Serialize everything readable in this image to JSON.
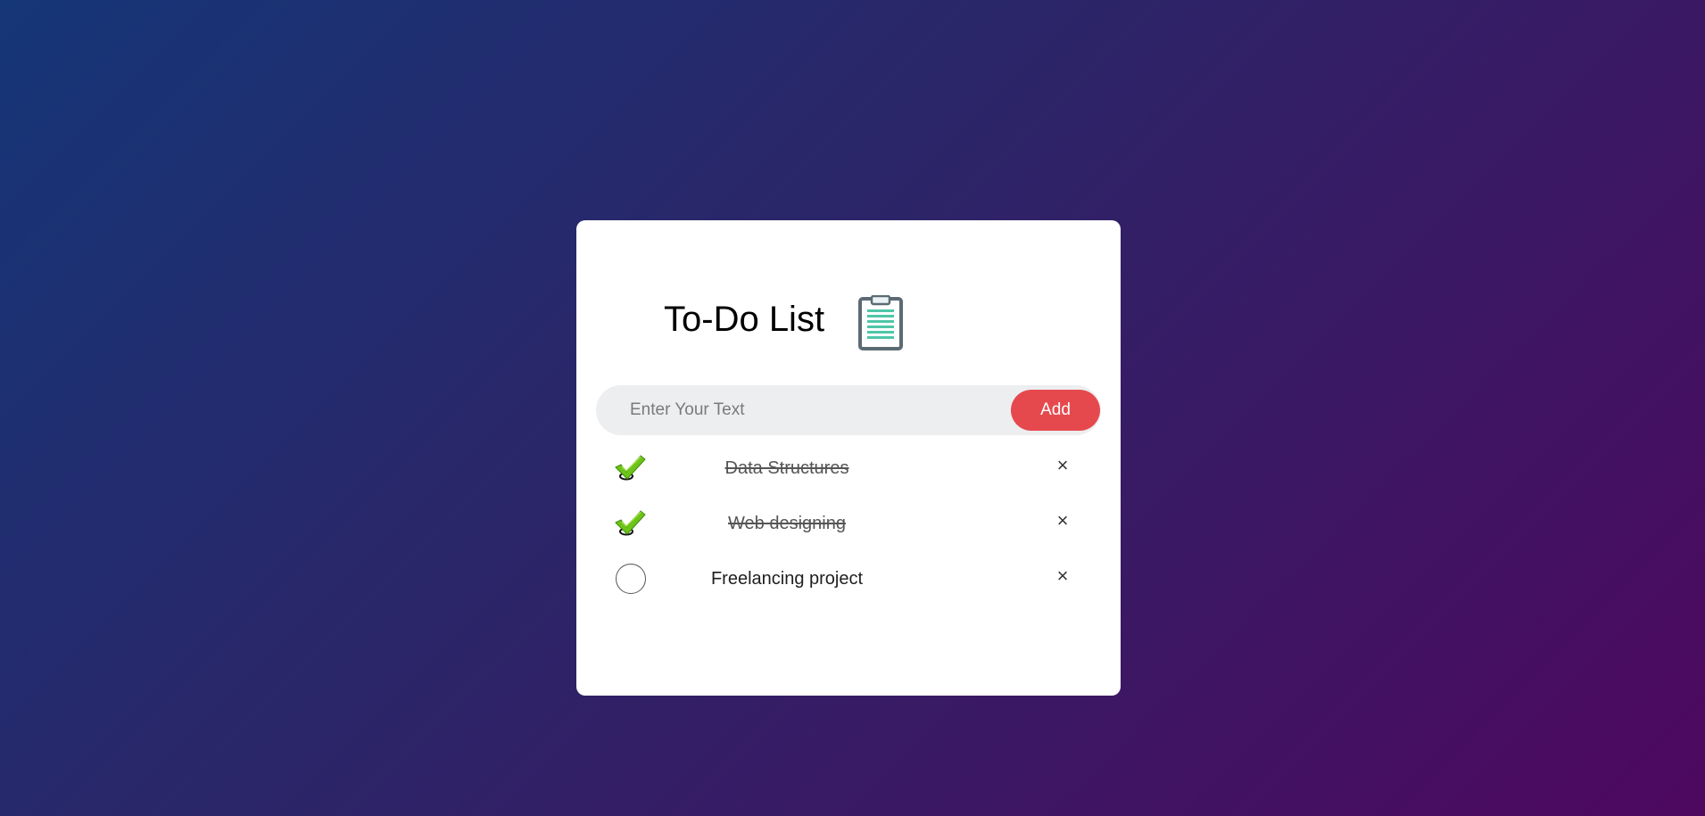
{
  "app": {
    "title": "To-Do List",
    "clipboard_icon": "clipboard-icon"
  },
  "input": {
    "placeholder": "Enter Your Text",
    "value": "",
    "add_label": "Add"
  },
  "tasks": [
    {
      "text": "Data Structures",
      "done": true,
      "remove_label": "×"
    },
    {
      "text": "Web designing",
      "done": true,
      "remove_label": "×"
    },
    {
      "text": "Freelancing project",
      "done": false,
      "remove_label": "×"
    }
  ],
  "colors": {
    "accent": "#e6494d",
    "check_green": "#6cc417",
    "clipboard_teal": "#4fc6a8",
    "clipboard_frame": "#5c6b73"
  }
}
